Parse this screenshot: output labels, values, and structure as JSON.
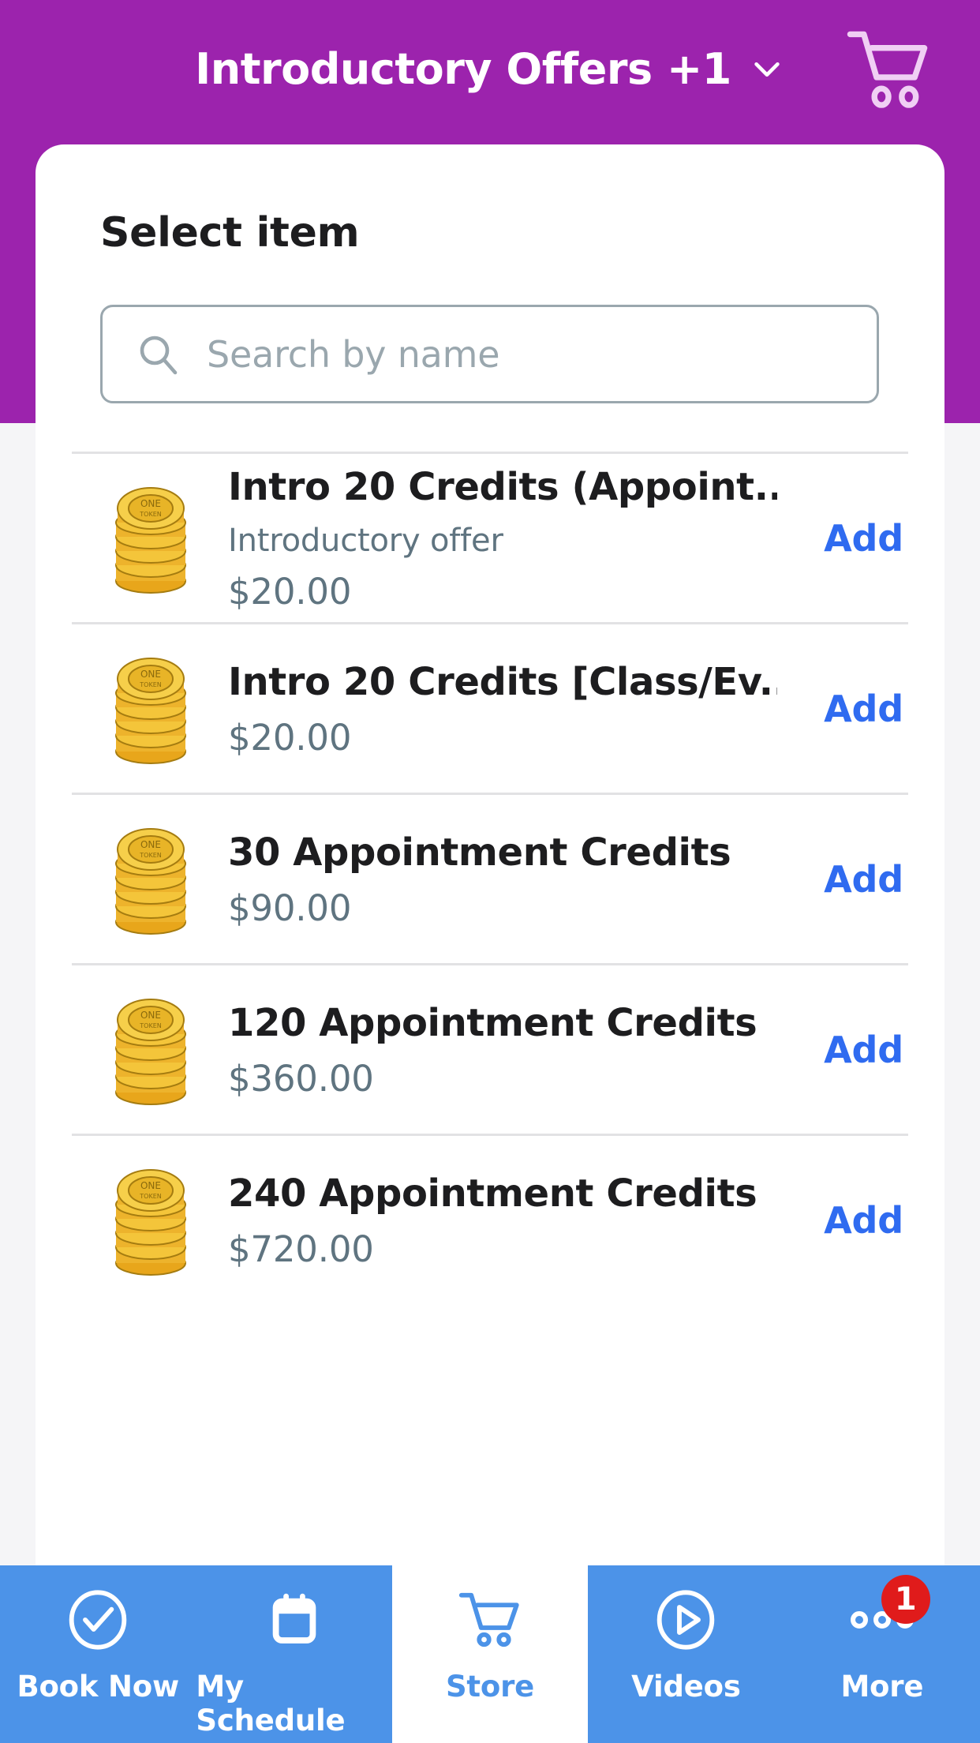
{
  "theme": {
    "header_purple": "#9c23ad",
    "tab_blue": "#4c93e8",
    "add_link_blue": "#2f6bf0",
    "badge_red": "#e01b1b",
    "muted_text": "#5f7480"
  },
  "header": {
    "title": "Introductory Offers +1",
    "chevron_icon": "chevron-down-icon",
    "cart_icon": "shopping-cart-icon"
  },
  "card": {
    "title": "Select item"
  },
  "search": {
    "icon": "search-icon",
    "value": "",
    "placeholder": "Search by name"
  },
  "items": [
    {
      "thumb_icon": "coin-stack-icon",
      "title": "Intro 20 Credits (Appoint...",
      "subtitle": "Introductory offer",
      "price": "$20.00",
      "action_label": "Add"
    },
    {
      "thumb_icon": "coin-stack-icon",
      "title": "Intro 20 Credits [Class/Ev...",
      "subtitle": "",
      "price": "$20.00",
      "action_label": "Add"
    },
    {
      "thumb_icon": "coin-stack-icon",
      "title": "30 Appointment Credits",
      "subtitle": "",
      "price": "$90.00",
      "action_label": "Add"
    },
    {
      "thumb_icon": "coin-stack-icon",
      "title": "120 Appointment Credits",
      "subtitle": "",
      "price": "$360.00",
      "action_label": "Add"
    },
    {
      "thumb_icon": "coin-stack-icon",
      "title": "240 Appointment Credits",
      "subtitle": "",
      "price": "$720.00",
      "action_label": "Add"
    }
  ],
  "tabbar": {
    "tabs": [
      {
        "label": "Book Now",
        "icon": "check-circle-icon",
        "active": false,
        "badge": ""
      },
      {
        "label": "My Schedule",
        "icon": "calendar-icon",
        "active": false,
        "badge": ""
      },
      {
        "label": "Store",
        "icon": "shopping-cart-icon",
        "active": true,
        "badge": ""
      },
      {
        "label": "Videos",
        "icon": "play-circle-icon",
        "active": false,
        "badge": ""
      },
      {
        "label": "More",
        "icon": "ellipsis-icon",
        "active": false,
        "badge": "1"
      }
    ]
  }
}
